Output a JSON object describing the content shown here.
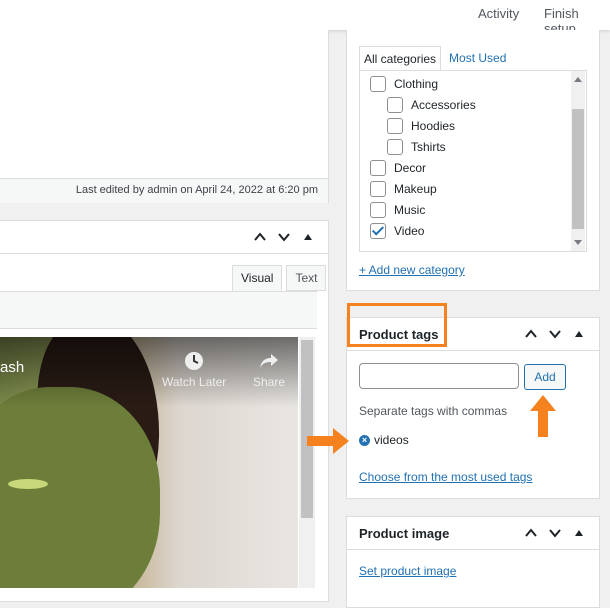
{
  "topbar": {
    "activity_label": "Activity",
    "finish_setup_label": "Finish setup"
  },
  "editor": {
    "last_edited": "Last edited by admin on April 24, 2022 at 6:20 pm",
    "tabs": [
      "Visual",
      "Text"
    ],
    "active_tab": "Visual"
  },
  "video": {
    "title_fragment": "ash",
    "watch_later_label": "Watch Later",
    "share_label": "Share"
  },
  "categories": {
    "tabs": [
      "All categories",
      "Most Used"
    ],
    "active_tab": "All categories",
    "items": [
      {
        "label": "Clothing",
        "checked": false,
        "level": 0
      },
      {
        "label": "Accessories",
        "checked": false,
        "level": 1
      },
      {
        "label": "Hoodies",
        "checked": false,
        "level": 1
      },
      {
        "label": "Tshirts",
        "checked": false,
        "level": 1
      },
      {
        "label": "Decor",
        "checked": false,
        "level": 0
      },
      {
        "label": "Makeup",
        "checked": false,
        "level": 0
      },
      {
        "label": "Music",
        "checked": false,
        "level": 0
      },
      {
        "label": "Video",
        "checked": true,
        "level": 0
      }
    ],
    "add_new_label": "+ Add new category"
  },
  "product_tags": {
    "title": "Product tags",
    "input_value": "",
    "add_button_label": "Add",
    "hint": "Separate tags with commas",
    "tags": [
      "videos"
    ],
    "most_used_link": "Choose from the most used tags"
  },
  "product_image": {
    "title": "Product image",
    "set_link": "Set product image"
  },
  "colors": {
    "annotation": "#f5821f",
    "link": "#2271b1"
  }
}
